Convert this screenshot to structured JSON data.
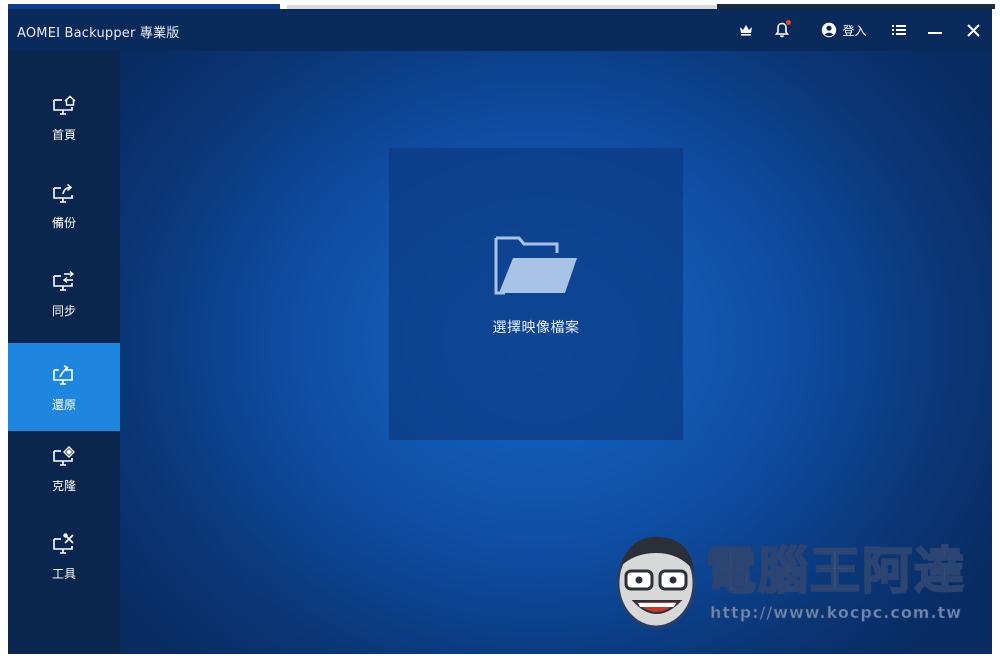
{
  "window": {
    "title": "AOMEI Backupper 專業版"
  },
  "titlebar": {
    "crown_icon": "crown-icon",
    "bell_icon": "bell-icon",
    "login_label": "登入",
    "menu_icon": "menu-icon",
    "minimize_icon": "minimize-icon",
    "close_icon": "close-icon"
  },
  "sidebar": {
    "items": [
      {
        "label": "首頁",
        "icon": "home-monitor-icon",
        "active": false
      },
      {
        "label": "備份",
        "icon": "backup-monitor-icon",
        "active": false
      },
      {
        "label": "同步",
        "icon": "sync-monitor-icon",
        "active": false
      },
      {
        "label": "還原",
        "icon": "restore-monitor-icon",
        "active": true
      },
      {
        "label": "克隆",
        "icon": "clone-monitor-icon",
        "active": false
      },
      {
        "label": "工具",
        "icon": "tools-monitor-icon",
        "active": false
      }
    ]
  },
  "main": {
    "select_image_label": "選擇映像檔案",
    "folder_icon": "open-folder-icon"
  },
  "watermark": {
    "text": "電腦王阿達",
    "url": "http://www.kocpc.com.tw"
  },
  "colors": {
    "titlebar": "#0a2a5c",
    "sidebar": "#0b264e",
    "active_item": "#1f86e0",
    "main_center": "#1566c4",
    "main_edge": "#082c62",
    "notification_dot": "#ff3b30"
  }
}
